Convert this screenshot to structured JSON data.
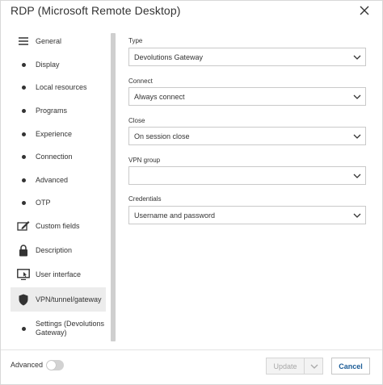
{
  "window": {
    "title": "RDP (Microsoft Remote Desktop)",
    "close_icon": "close-icon"
  },
  "sidebar": {
    "items": [
      {
        "label": "General",
        "icon": "hamburger-icon"
      },
      {
        "label": "Display",
        "icon": "bullet-icon"
      },
      {
        "label": "Local resources",
        "icon": "bullet-icon"
      },
      {
        "label": "Programs",
        "icon": "bullet-icon"
      },
      {
        "label": "Experience",
        "icon": "bullet-icon"
      },
      {
        "label": "Connection",
        "icon": "bullet-icon"
      },
      {
        "label": "Advanced",
        "icon": "bullet-icon"
      },
      {
        "label": "OTP",
        "icon": "bullet-icon"
      },
      {
        "label": "Custom fields",
        "icon": "edit-icon"
      },
      {
        "label": "Description",
        "icon": "lock-icon"
      },
      {
        "label": "User interface",
        "icon": "monitor-icon"
      },
      {
        "label": "VPN/tunnel/gateway",
        "icon": "shield-icon",
        "selected": true
      },
      {
        "label": "Settings (Devolutions Gateway)",
        "icon": "bullet-icon"
      }
    ]
  },
  "form": {
    "type": {
      "label": "Type",
      "value": "Devolutions Gateway"
    },
    "connect": {
      "label": "Connect",
      "value": "Always connect"
    },
    "close": {
      "label": "Close",
      "value": "On session close"
    },
    "vpn_group": {
      "label": "VPN group",
      "value": ""
    },
    "credentials": {
      "label": "Credentials",
      "value": "Username and password"
    }
  },
  "footer": {
    "advanced_label": "Advanced",
    "advanced_enabled": false,
    "update_label": "Update",
    "update_enabled": false,
    "cancel_label": "Cancel"
  },
  "colors": {
    "accent": "#1a5b96",
    "selected_bg": "#ececec",
    "border": "#c9c9c9"
  }
}
